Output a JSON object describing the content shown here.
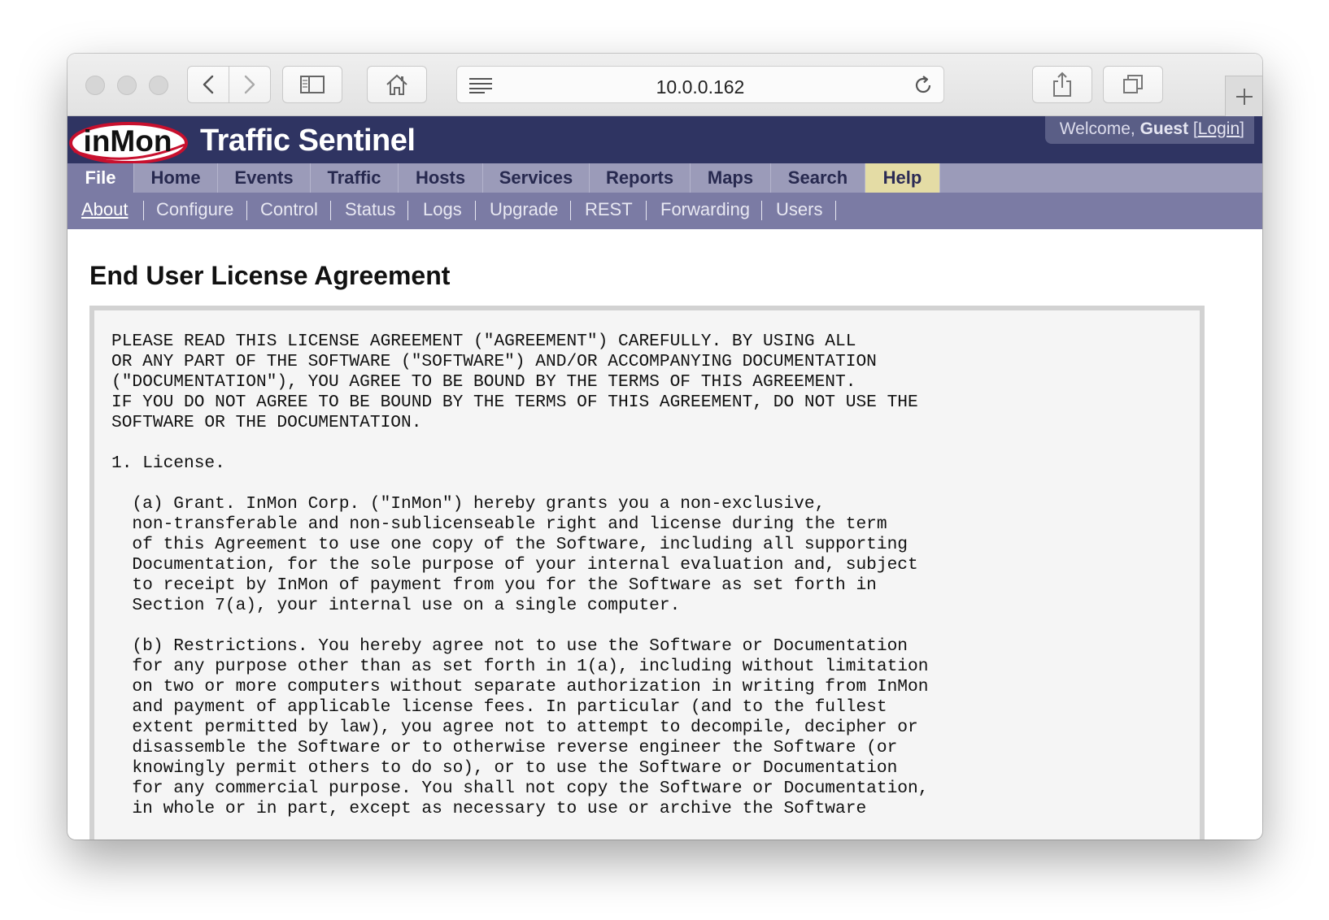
{
  "browser": {
    "url": "10.0.0.162",
    "icons": [
      "back-icon",
      "forward-icon",
      "sidebar-icon",
      "home-icon",
      "reader-icon",
      "reload-icon",
      "share-icon",
      "tabs-icon",
      "plus-icon"
    ]
  },
  "header": {
    "logo_text": "inMon",
    "title": "Traffic Sentinel",
    "welcome_prefix": "Welcome,",
    "user": "Guest",
    "login_label": "Login",
    "colors": {
      "header_bg": "#2f3462",
      "nav_bg": "#9b9bb9",
      "subnav_bg": "#7b7ba4",
      "help_tab": "#e4dca5"
    }
  },
  "nav": {
    "tabs": [
      {
        "label": "File"
      },
      {
        "label": "Home"
      },
      {
        "label": "Events"
      },
      {
        "label": "Traffic"
      },
      {
        "label": "Hosts"
      },
      {
        "label": "Services"
      },
      {
        "label": "Reports"
      },
      {
        "label": "Maps"
      },
      {
        "label": "Search"
      },
      {
        "label": "Help"
      }
    ],
    "subitems": [
      {
        "label": "About"
      },
      {
        "label": "Configure"
      },
      {
        "label": "Control"
      },
      {
        "label": "Status"
      },
      {
        "label": "Logs"
      },
      {
        "label": "Upgrade"
      },
      {
        "label": "REST"
      },
      {
        "label": "Forwarding"
      },
      {
        "label": "Users"
      }
    ]
  },
  "page": {
    "title": "End User License Agreement",
    "license_text": "PLEASE READ THIS LICENSE AGREEMENT (\"AGREEMENT\") CAREFULLY. BY USING ALL\nOR ANY PART OF THE SOFTWARE (\"SOFTWARE\") AND/OR ACCOMPANYING DOCUMENTATION\n(\"DOCUMENTATION\"), YOU AGREE TO BE BOUND BY THE TERMS OF THIS AGREEMENT.\nIF YOU DO NOT AGREE TO BE BOUND BY THE TERMS OF THIS AGREEMENT, DO NOT USE THE\nSOFTWARE OR THE DOCUMENTATION.\n\n1. License.\n\n  (a) Grant. InMon Corp. (\"InMon\") hereby grants you a non-exclusive,\n  non-transferable and non-sublicenseable right and license during the term\n  of this Agreement to use one copy of the Software, including all supporting\n  Documentation, for the sole purpose of your internal evaluation and, subject\n  to receipt by InMon of payment from you for the Software as set forth in\n  Section 7(a), your internal use on a single computer.\n\n  (b) Restrictions. You hereby agree not to use the Software or Documentation\n  for any purpose other than as set forth in 1(a), including without limitation\n  on two or more computers without separate authorization in writing from InMon\n  and payment of applicable license fees. In particular (and to the fullest\n  extent permitted by law), you agree not to attempt to decompile, decipher or\n  disassemble the Software or to otherwise reverse engineer the Software (or\n  knowingly permit others to do so), or to use the Software or Documentation\n  for any commercial purpose. You shall not copy the Software or Documentation,\n  in whole or in part, except as necessary to use or archive the Software"
  }
}
